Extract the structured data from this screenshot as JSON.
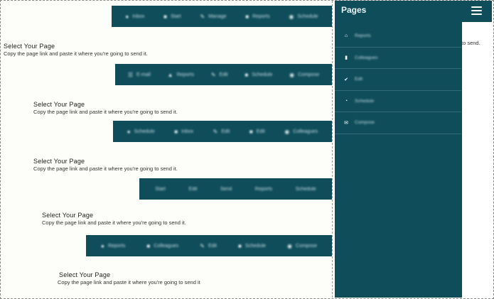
{
  "navbars": [
    {
      "items": [
        {
          "icon": "●",
          "label": "Inbox"
        },
        {
          "icon": "■",
          "label": "Start"
        },
        {
          "icon": "✎",
          "label": "Manage"
        },
        {
          "icon": "■",
          "label": "Reports"
        },
        {
          "icon": "◉",
          "label": "Schedule"
        }
      ]
    },
    {
      "items": [
        {
          "icon": "☰",
          "label": "E-mail"
        },
        {
          "icon": "▲",
          "label": "Reports"
        },
        {
          "icon": "✎",
          "label": "Edit"
        },
        {
          "icon": "■",
          "label": "Schedule"
        },
        {
          "icon": "◉",
          "label": "Compose"
        }
      ]
    },
    {
      "items": [
        {
          "icon": "●",
          "label": "Schedule"
        },
        {
          "icon": "■",
          "label": "Inbox"
        },
        {
          "icon": "✎",
          "label": "Edit"
        },
        {
          "icon": "■",
          "label": "Edit"
        },
        {
          "icon": "◉",
          "label": "Colleagues"
        }
      ]
    },
    {
      "items": [
        {
          "icon": "",
          "label": "Start"
        },
        {
          "icon": "",
          "label": "Edit"
        },
        {
          "icon": "",
          "label": "Send"
        },
        {
          "icon": "",
          "label": "Reports"
        },
        {
          "icon": "",
          "label": "Schedule"
        }
      ]
    },
    {
      "items": [
        {
          "icon": "●",
          "label": "Reports"
        },
        {
          "icon": "■",
          "label": "Colleagues"
        },
        {
          "icon": "✎",
          "label": "Edit"
        },
        {
          "icon": "■",
          "label": "Schedule"
        },
        {
          "icon": "◉",
          "label": "Compose"
        }
      ]
    }
  ],
  "blocks": [
    {
      "title": "Select Your Page",
      "sub": "Copy the page link and paste it where you're going to send it."
    },
    {
      "title": "Select Your Page",
      "sub": "Copy the page link and paste it where you're going to send it."
    },
    {
      "title": "Select Your Page",
      "sub": "Copy the page link and paste it where you're going to send it."
    },
    {
      "title": "Select Your Page",
      "sub": "Copy the page link and paste it where you're going to send it."
    },
    {
      "title": "Select Your Page",
      "sub": "Copy the page link and paste it where you're going to send it"
    }
  ],
  "drawer": {
    "title": "Pages",
    "items": [
      {
        "icon": "⌂",
        "label": "Reports"
      },
      {
        "icon": "▮",
        "label": "Colleagues"
      },
      {
        "icon": "✔",
        "label": "Edit"
      },
      {
        "icon": "◔",
        "label": "Schedule"
      },
      {
        "icon": "✉",
        "label": "Compose"
      }
    ]
  },
  "overflow_text": "to send.",
  "colors": {
    "primary": "#0f4d5b",
    "background": "#fdfdfa",
    "divider": "#2e6a77"
  }
}
